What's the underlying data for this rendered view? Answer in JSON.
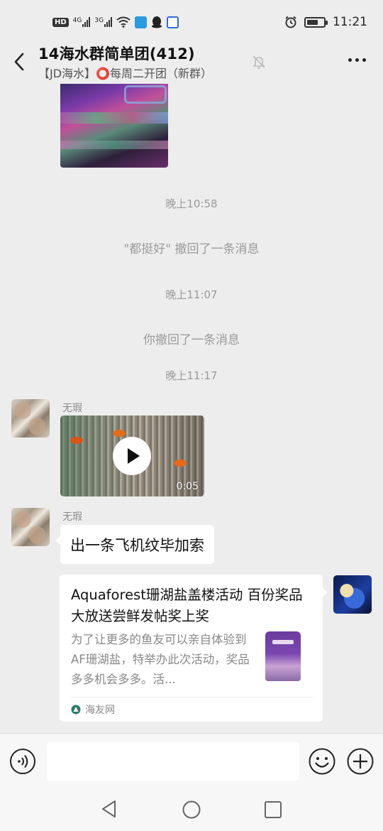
{
  "status_bar": {
    "hd_label": "HD",
    "sim1_label": "4G",
    "sim2_label": "3G",
    "time": "11:21",
    "battery_level": 0.7,
    "icons": [
      "hd-icon",
      "signal-4g-icon",
      "signal-3g-icon",
      "wifi-icon",
      "app-notification-icon",
      "qq-icon",
      "baidu-icon",
      "alarm-icon",
      "battery-icon"
    ]
  },
  "header": {
    "title": "14海水群简单团(412)",
    "subtitle": "【JD海水】⭕每周二开团（新群）",
    "muted": true
  },
  "messages": {
    "time1": "晚上10:58",
    "note1": "\"都挺好\" 撤回了一条消息",
    "time2": "晚上11:07",
    "note2": "你撤回了一条消息",
    "time3": "晚上11:17",
    "video_msg": {
      "sender": "无瑕",
      "duration": "0:05"
    },
    "text_msg": {
      "sender": "无瑕",
      "text": "出一条飞机纹毕加索"
    },
    "link_card": {
      "title": "Aquaforest珊湖盐盖楼活动 百份奖品大放送尝鲜发帖奖上奖",
      "description": "为了让更多的鱼友可以亲自体验到AF珊湖盐，特举办此次活动，奖品多多机会多多。活...",
      "source": "海友网"
    }
  },
  "input_bar": {
    "placeholder": "",
    "icons": [
      "voice-icon",
      "emoji-icon",
      "plus-icon"
    ]
  },
  "nav_bar": {
    "icons": [
      "nav-back-icon",
      "nav-home-icon",
      "nav-recent-icon"
    ]
  },
  "colors": {
    "chat_bg": "#ededed",
    "bubble_bg": "#ffffff",
    "system_text": "#9a9a9a"
  }
}
